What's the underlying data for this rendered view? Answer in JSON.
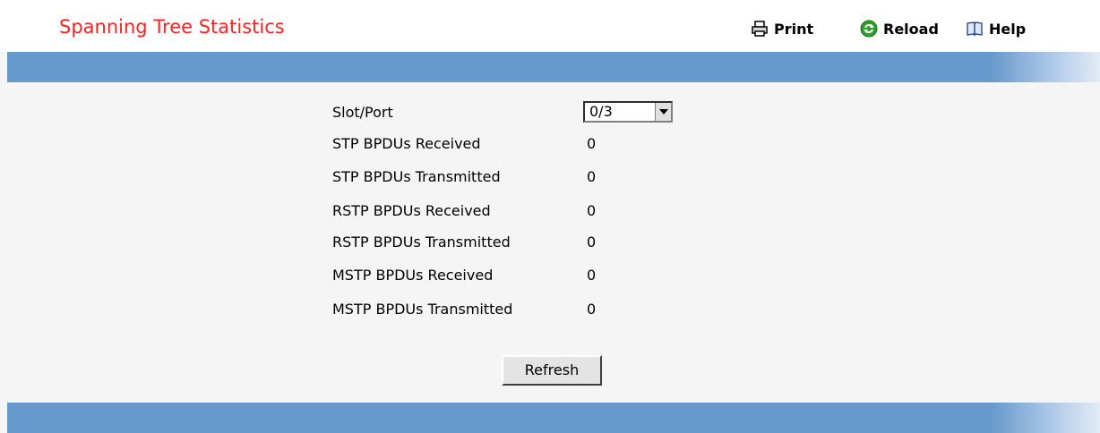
{
  "header": {
    "title": "Spanning Tree Statistics",
    "print_label": "Print",
    "reload_label": "Reload",
    "help_label": "Help"
  },
  "form": {
    "slot_port_label": "Slot/Port",
    "slot_port_value": "0/3",
    "rows": [
      {
        "label": "STP BPDUs Received",
        "value": "0"
      },
      {
        "label": "STP BPDUs Transmitted",
        "value": "0"
      },
      {
        "label": "RSTP BPDUs Received",
        "value": "0"
      },
      {
        "label": "RSTP BPDUs Transmitted",
        "value": "0"
      },
      {
        "label": "MSTP BPDUs Received",
        "value": "0"
      },
      {
        "label": "MSTP BPDUs Transmitted",
        "value": "0"
      }
    ]
  },
  "actions": {
    "refresh_label": "Refresh"
  },
  "colors": {
    "title": "#ff2020",
    "band": "#6699cc",
    "background": "#f5f5f5"
  },
  "icons": [
    "printer-icon",
    "reload-icon",
    "help-book-icon",
    "dropdown-arrow-icon"
  ]
}
